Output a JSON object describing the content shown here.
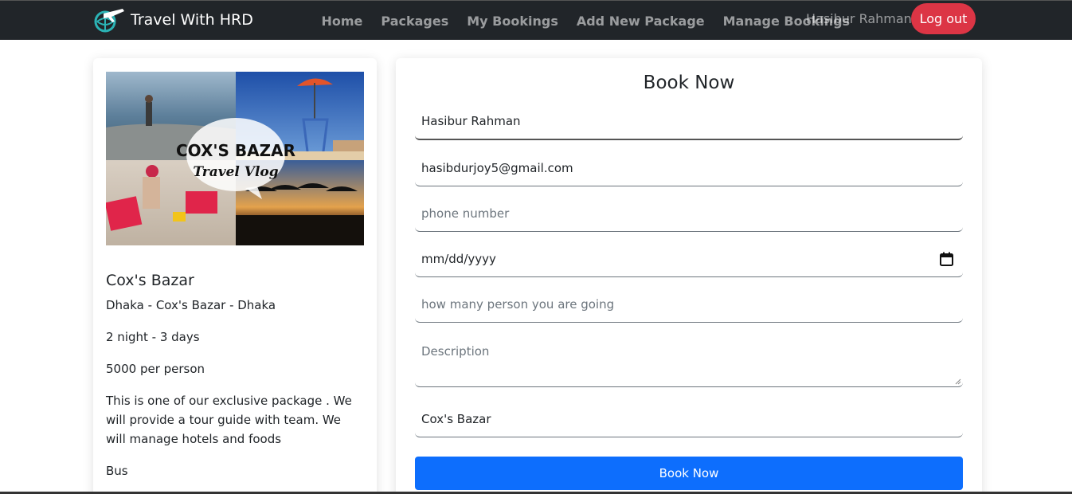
{
  "navbar": {
    "brand": "Travel With HRD",
    "links": [
      "Home",
      "Packages",
      "My Bookings",
      "Add New Package",
      "Manage Bookings"
    ],
    "user_name": "Hasibur Rahman",
    "logout_label": "Log out"
  },
  "package": {
    "image_title": "COX'S BAZAR",
    "image_subtitle": "Travel Vlog",
    "name": "Cox's Bazar",
    "route": "Dhaka - Cox's Bazar - Dhaka",
    "duration": "2 night - 3 days",
    "price": "5000 per person",
    "description": "This is one of our exclusive package . We will provide a tour guide with team. We will manage hotels and foods",
    "transport": "Bus"
  },
  "booking_form": {
    "title": "Book Now",
    "name_value": "Hasibur Rahman",
    "email_value": "hasibdurjoy5@gmail.com",
    "phone_placeholder": "phone number",
    "date_placeholder": "mm/dd/yyyy",
    "persons_placeholder": "how many person you are going",
    "description_placeholder": "Description",
    "package_value": "Cox's Bazar",
    "submit_label": "Book Now"
  },
  "colors": {
    "navbar_bg": "#212529",
    "logout_red": "#dc3545",
    "primary_blue": "#0d6efd"
  }
}
